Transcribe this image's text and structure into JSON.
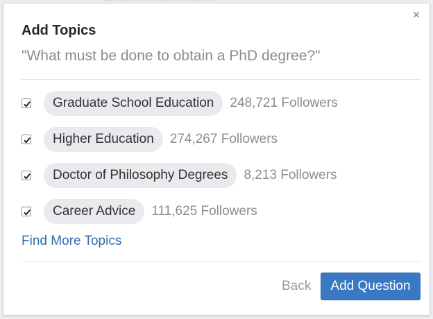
{
  "dialog": {
    "title": "Add Topics",
    "question": "\"What must be done to obtain a PhD degree?\"",
    "close_icon": "close-icon"
  },
  "topics": [
    {
      "name": "Graduate School Education",
      "followers": "248,721 Followers",
      "checked": true
    },
    {
      "name": "Higher Education",
      "followers": "274,267 Followers",
      "checked": true
    },
    {
      "name": "Doctor of Philosophy Degrees",
      "followers": "8,213 Followers",
      "checked": true
    },
    {
      "name": "Career Advice",
      "followers": "111,625 Followers",
      "checked": true
    }
  ],
  "links": {
    "find_more": "Find More Topics"
  },
  "actions": {
    "back_label": "Back",
    "add_label": "Add Question"
  },
  "colors": {
    "accent": "#3a78c3",
    "link": "#2b6dad",
    "chip_bg": "#e9e9ee",
    "muted_text": "#8c8c8c"
  }
}
